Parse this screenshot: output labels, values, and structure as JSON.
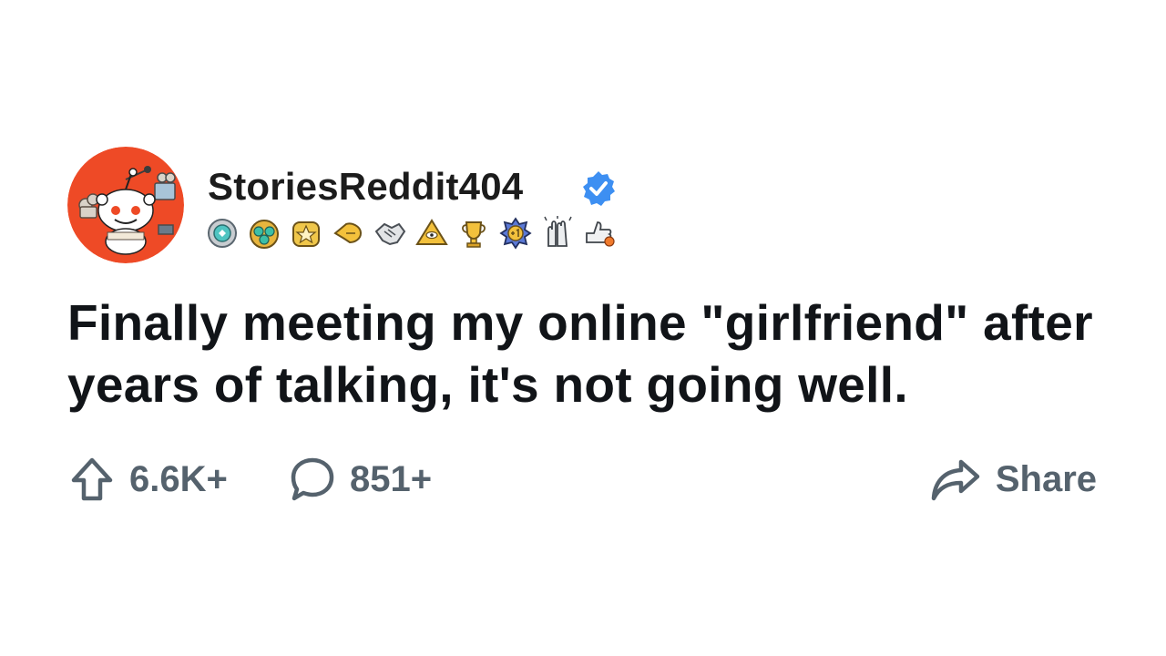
{
  "post": {
    "author": {
      "username": "StoriesReddit404",
      "verified": true,
      "avatar": "reddit-snoo-avatar"
    },
    "awards": [
      "shield-gem-award",
      "triple-gem-award",
      "gold-star-award",
      "pointing-hand-award",
      "handshake-award",
      "pyramid-eye-award",
      "trophy-award",
      "plus-one-award",
      "clapping-hands-award",
      "thumbs-up-award"
    ],
    "title": "Finally meeting my online \"girlfriend\" after years of talking, it's not going well.",
    "upvotes": "6.6K+",
    "comments": "851+",
    "share_label": "Share"
  },
  "colors": {
    "avatar_bg": "#ee4a26",
    "verified": "#3d8ff2",
    "text": "#111418",
    "muted": "#55626d"
  }
}
